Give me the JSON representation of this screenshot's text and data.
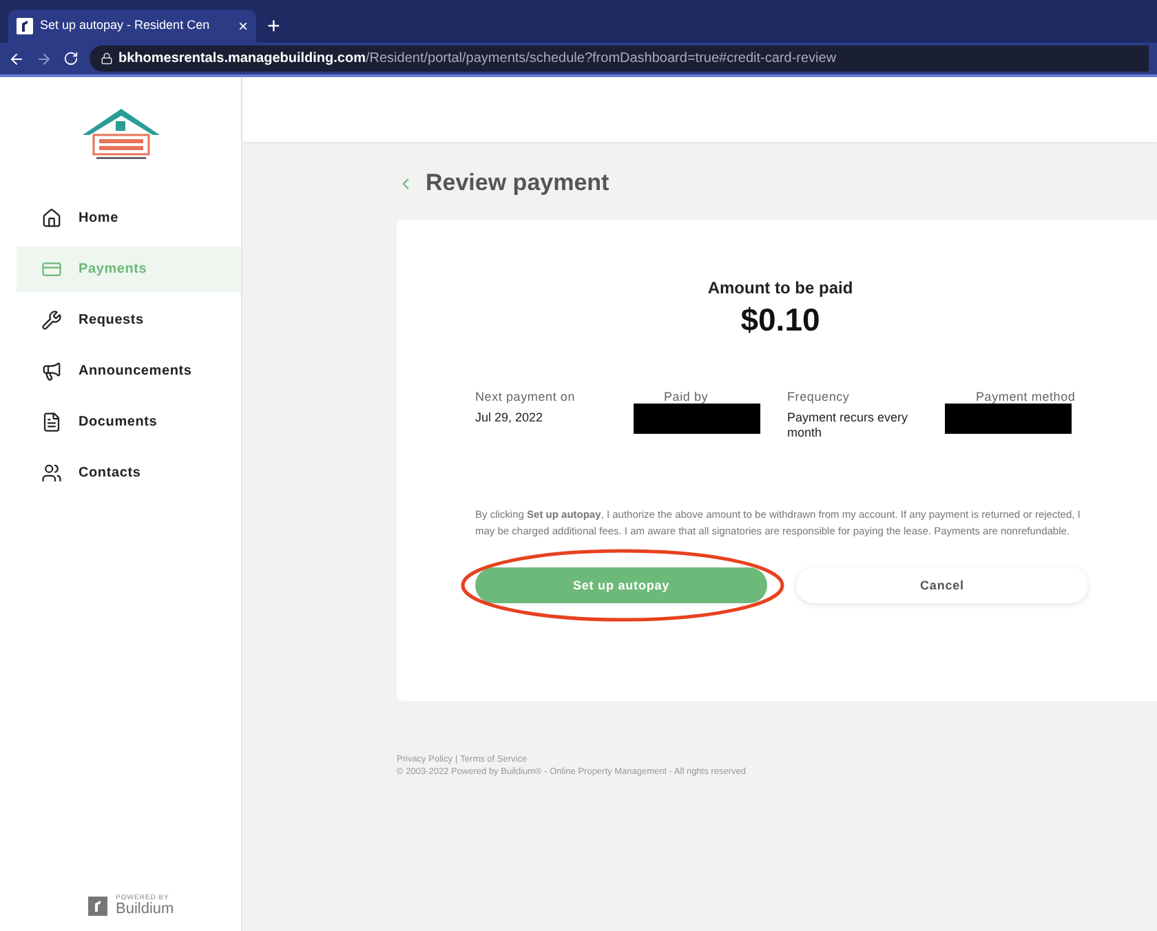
{
  "browser": {
    "tab_title": "Set up autopay - Resident Cen",
    "tab_close": "×",
    "new_tab": "+",
    "url_host": "bkhomesrentals.managebuilding.com",
    "url_path": "/Resident/portal/payments/schedule?fromDashboard=true#credit-card-review"
  },
  "sidebar": {
    "items": [
      {
        "label": "Home",
        "selected": false
      },
      {
        "label": "Payments",
        "selected": true
      },
      {
        "label": "Requests",
        "selected": false
      },
      {
        "label": "Announcements",
        "selected": false
      },
      {
        "label": "Documents",
        "selected": false
      },
      {
        "label": "Contacts",
        "selected": false
      }
    ],
    "powered_by": "POWERED BY",
    "brand": "Buildium"
  },
  "page": {
    "title": "Review payment",
    "amount_label": "Amount to be paid",
    "amount": "$0.10",
    "details": [
      {
        "label": "Next payment on",
        "value": "Jul 29, 2022",
        "redacted": false
      },
      {
        "label": "Paid by",
        "redacted": true
      },
      {
        "label": "Frequency",
        "value": "Payment recurs every month",
        "redacted": false
      },
      {
        "label": "Payment method",
        "redacted": true
      }
    ],
    "disclaimer": "By clicking **Set up autopay**, I authorize the above amount to be withdrawn from my account. If any payment is returned or rejected, I may be charged additional fees. I am aware that all signatories are responsible for paying the lease. Payments are nonrefundable.",
    "primary_button": "Set up autopay",
    "cancel_button": "Cancel"
  },
  "footer": {
    "links": [
      "Privacy Policy",
      "Terms of Service"
    ],
    "separator": "|",
    "copyright": "© 2003-2022 Powered by Buildium® - Online Property Management - All rights reserved"
  }
}
